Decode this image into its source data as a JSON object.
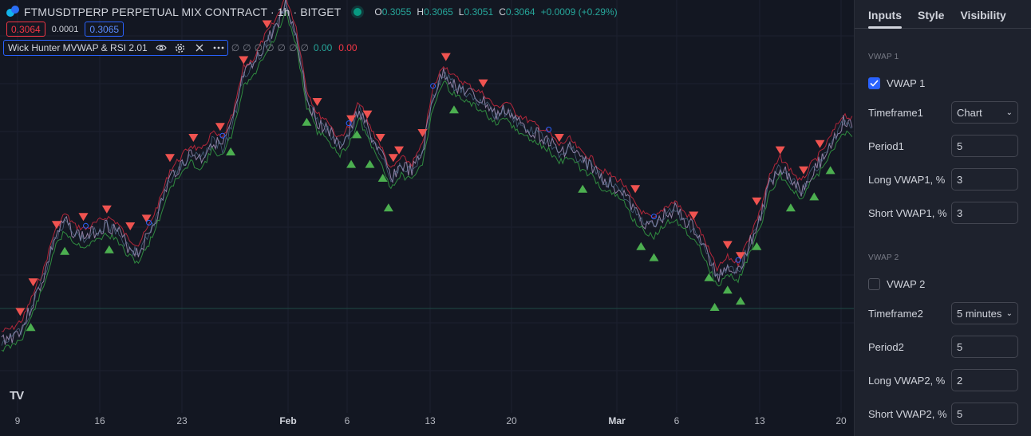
{
  "header": {
    "symbol_title": "FTMUSDTPERP PERPETUAL MIX CONTRACT · 1h · BITGET",
    "ohlc": [
      {
        "key": "O",
        "value": "0.3055"
      },
      {
        "key": "H",
        "value": "0.3065"
      },
      {
        "key": "L",
        "value": "0.3051"
      },
      {
        "key": "C",
        "value": "0.3064"
      }
    ],
    "change": "+0.0009 (+0.29%)"
  },
  "trade": {
    "sell_price": "0.3064",
    "spread": "0.0001",
    "buy_price": "0.3065"
  },
  "indicator": {
    "name": "Wick Hunter MVWAP & RSI 2.01",
    "values_dim": [
      "∅",
      "∅",
      "∅",
      "∅",
      "∅",
      "∅",
      "∅"
    ],
    "value_green": "0.00",
    "value_red": "0.00"
  },
  "xaxis": {
    "ticks": [
      {
        "label": "9",
        "bold": false
      },
      {
        "label": "16",
        "bold": false
      },
      {
        "label": "23",
        "bold": false
      },
      {
        "label": "Feb",
        "bold": true
      },
      {
        "label": "6",
        "bold": false
      },
      {
        "label": "13",
        "bold": false
      },
      {
        "label": "20",
        "bold": false
      },
      {
        "label": "Mar",
        "bold": true
      },
      {
        "label": "6",
        "bold": false
      },
      {
        "label": "13",
        "bold": false
      },
      {
        "label": "20",
        "bold": false
      }
    ]
  },
  "logo": "TV",
  "colors": {
    "background": "#131722",
    "panel": "#1e222d",
    "price_line": "#8f7fa3",
    "upper_band": "#b2263a",
    "lower_band": "#2f8a3f",
    "sell_signal": "#ef5350",
    "buy_signal": "#4caf50",
    "dot": "#2962ff",
    "accent": "#2962ff"
  },
  "chart_data": {
    "type": "line",
    "title": "",
    "xlabel": "",
    "ylabel": "",
    "x_labels": [
      "9",
      "16",
      "23",
      "Feb",
      "6",
      "13",
      "20",
      "Mar",
      "6",
      "13",
      "20"
    ],
    "series": [
      {
        "values": [
          0.1,
          0.11,
          0.14,
          0.22,
          0.3,
          0.42,
          0.48,
          0.44,
          0.43,
          0.45,
          0.47,
          0.45,
          0.4,
          0.38,
          0.44,
          0.52,
          0.62,
          0.66,
          0.7,
          0.68,
          0.74,
          0.72,
          0.8,
          0.95,
          0.98,
          1.05,
          1.1,
          1.18,
          1.08,
          0.88,
          0.8,
          0.78,
          0.72,
          0.76,
          0.84,
          0.76,
          0.7,
          0.62,
          0.66,
          0.64,
          0.7,
          0.88,
          0.96,
          0.92,
          0.9,
          0.88,
          0.86,
          0.82,
          0.84,
          0.8,
          0.78,
          0.76,
          0.74,
          0.7,
          0.72,
          0.68,
          0.66,
          0.62,
          0.6,
          0.58,
          0.52,
          0.48,
          0.46,
          0.5,
          0.52,
          0.48,
          0.45,
          0.38,
          0.3,
          0.34,
          0.32,
          0.4,
          0.48,
          0.6,
          0.66,
          0.62,
          0.58,
          0.64,
          0.68,
          0.74,
          0.8,
          0.78
        ]
      }
    ],
    "signals_sell": [
      2,
      3,
      5,
      8,
      10,
      12,
      14,
      16,
      18,
      21,
      23,
      25,
      27,
      30,
      33,
      35,
      36,
      37,
      38,
      40,
      42,
      46,
      53,
      60,
      66,
      69,
      70,
      72,
      74,
      76,
      78
    ],
    "signals_buy": [
      3,
      6,
      10,
      22,
      29,
      33,
      34,
      35,
      36,
      37,
      43,
      55,
      61,
      62,
      67,
      68,
      69,
      70,
      72,
      75,
      77,
      79
    ]
  },
  "panel": {
    "tabs": [
      {
        "label": "Inputs",
        "active": true
      },
      {
        "label": "Style",
        "active": false
      },
      {
        "label": "Visibility",
        "active": false
      }
    ],
    "vwap1": {
      "section": "VWAP 1",
      "checkbox_label": "VWAP 1",
      "checked": true,
      "timeframe_label": "Timeframe1",
      "timeframe_value": "Chart",
      "period_label": "Period1",
      "period_value": "5",
      "long_label": "Long VWAP1, %",
      "long_value": "3",
      "short_label": "Short VWAP1, %",
      "short_value": "3"
    },
    "vwap2": {
      "section": "VWAP 2",
      "checkbox_label": "VWAP 2",
      "checked": false,
      "timeframe_label": "Timeframe2",
      "timeframe_value": "5 minutes",
      "period_label": "Period2",
      "period_value": "5",
      "long_label": "Long VWAP2, %",
      "long_value": "2",
      "short_label": "Short VWAP2, %",
      "short_value": "5"
    }
  }
}
